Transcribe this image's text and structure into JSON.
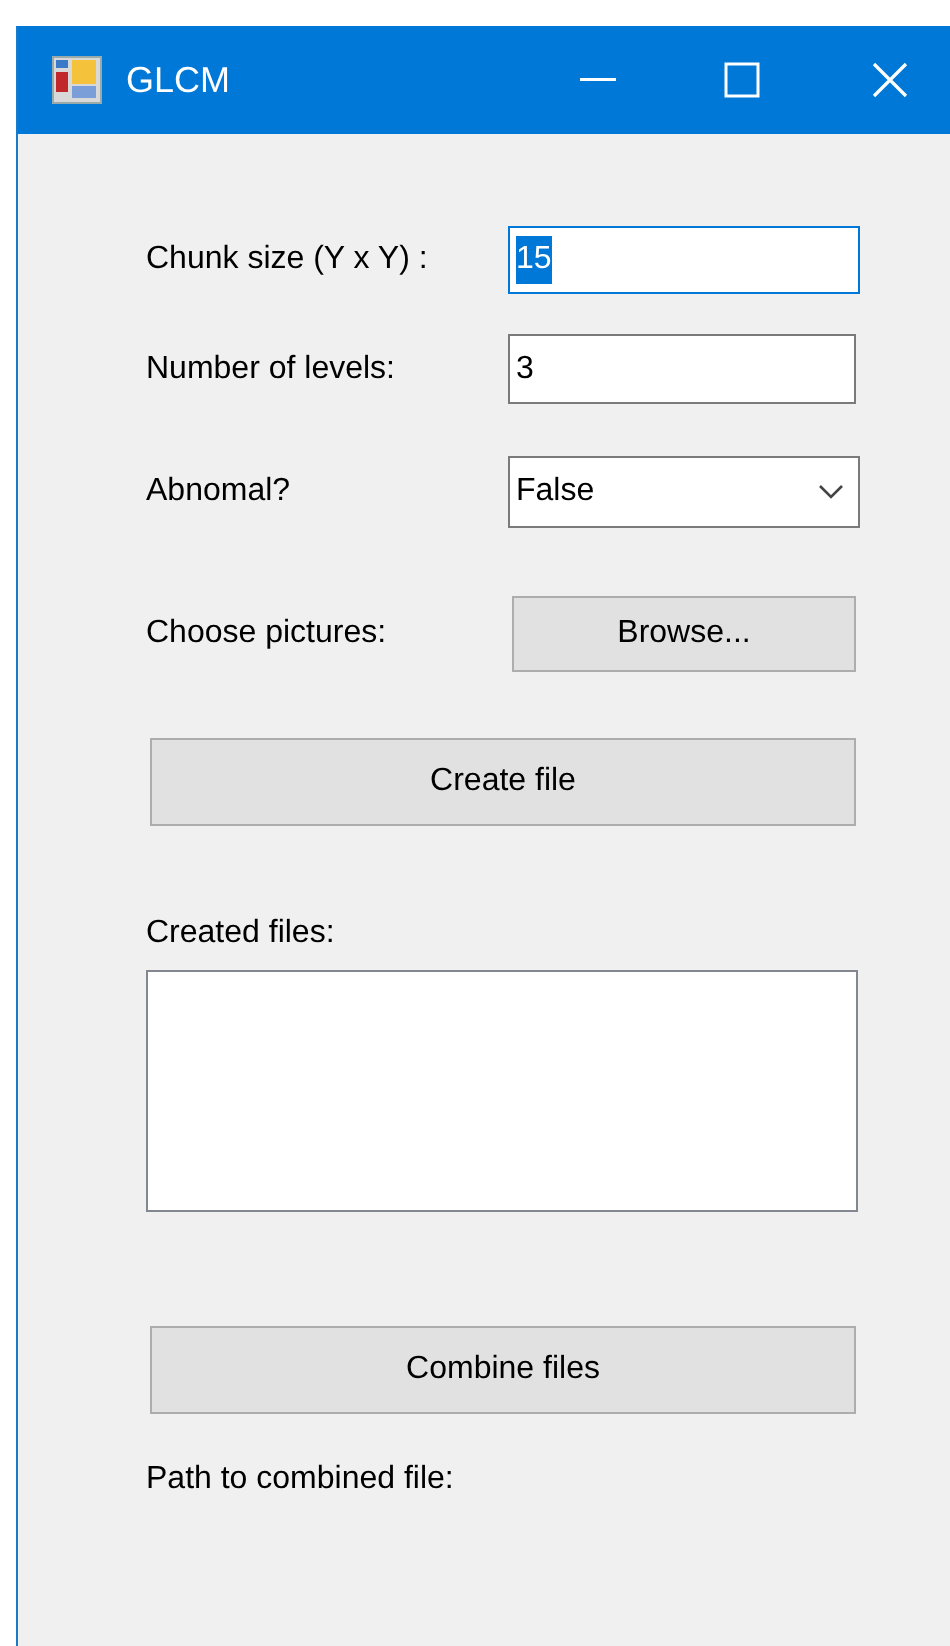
{
  "window": {
    "title": "GLCM"
  },
  "fields": [
    {
      "label": "Chunk size (Y x Y) :",
      "kind": "text",
      "value": "15",
      "focused": true
    },
    {
      "label": "Number of levels:",
      "kind": "text",
      "value": "3",
      "focused": false
    },
    {
      "label": "Abnomal?",
      "kind": "combo",
      "value": "False",
      "focused": false
    },
    {
      "label": "Choose pictures:",
      "kind": "button",
      "value": "Browse...",
      "focused": false
    }
  ],
  "create_button": "Create file",
  "created_files": {
    "label": "Created files:"
  },
  "combine_button": "Combine files",
  "path_label": "Path to combined file:"
}
